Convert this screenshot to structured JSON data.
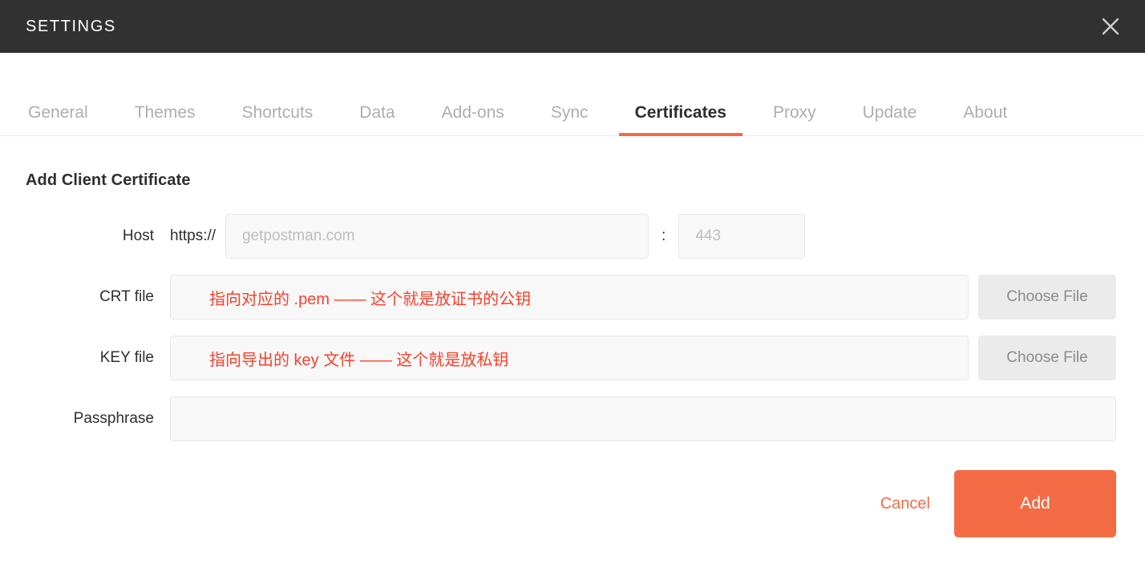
{
  "window": {
    "title": "SETTINGS",
    "close_icon": "close-icon"
  },
  "tabs": [
    {
      "label": "General",
      "active": false
    },
    {
      "label": "Themes",
      "active": false
    },
    {
      "label": "Shortcuts",
      "active": false
    },
    {
      "label": "Data",
      "active": false
    },
    {
      "label": "Add-ons",
      "active": false
    },
    {
      "label": "Sync",
      "active": false
    },
    {
      "label": "Certificates",
      "active": true
    },
    {
      "label": "Proxy",
      "active": false
    },
    {
      "label": "Update",
      "active": false
    },
    {
      "label": "About",
      "active": false
    }
  ],
  "form": {
    "section_title": "Add Client Certificate",
    "host": {
      "label": "Host",
      "scheme": "https://",
      "value": "",
      "placeholder": "getpostman.com",
      "separator": ":",
      "port_value": "",
      "port_placeholder": "443"
    },
    "crt": {
      "label": "CRT file",
      "value": "指向对应的 .pem —— 这个就是放证书的公钥",
      "button_label": "Choose File"
    },
    "key": {
      "label": "KEY file",
      "value": "指向导出的 key 文件 —— 这个就是放私钥",
      "button_label": "Choose File"
    },
    "passphrase": {
      "label": "Passphrase",
      "value": "",
      "placeholder": ""
    }
  },
  "actions": {
    "cancel_label": "Cancel",
    "add_label": "Add"
  },
  "colors": {
    "accent": "#f26b45",
    "titlebar": "#313131",
    "annotation_red": "#f8402b",
    "field_bg": "#f8f8f8",
    "tab_inactive": "#aeaeae"
  }
}
